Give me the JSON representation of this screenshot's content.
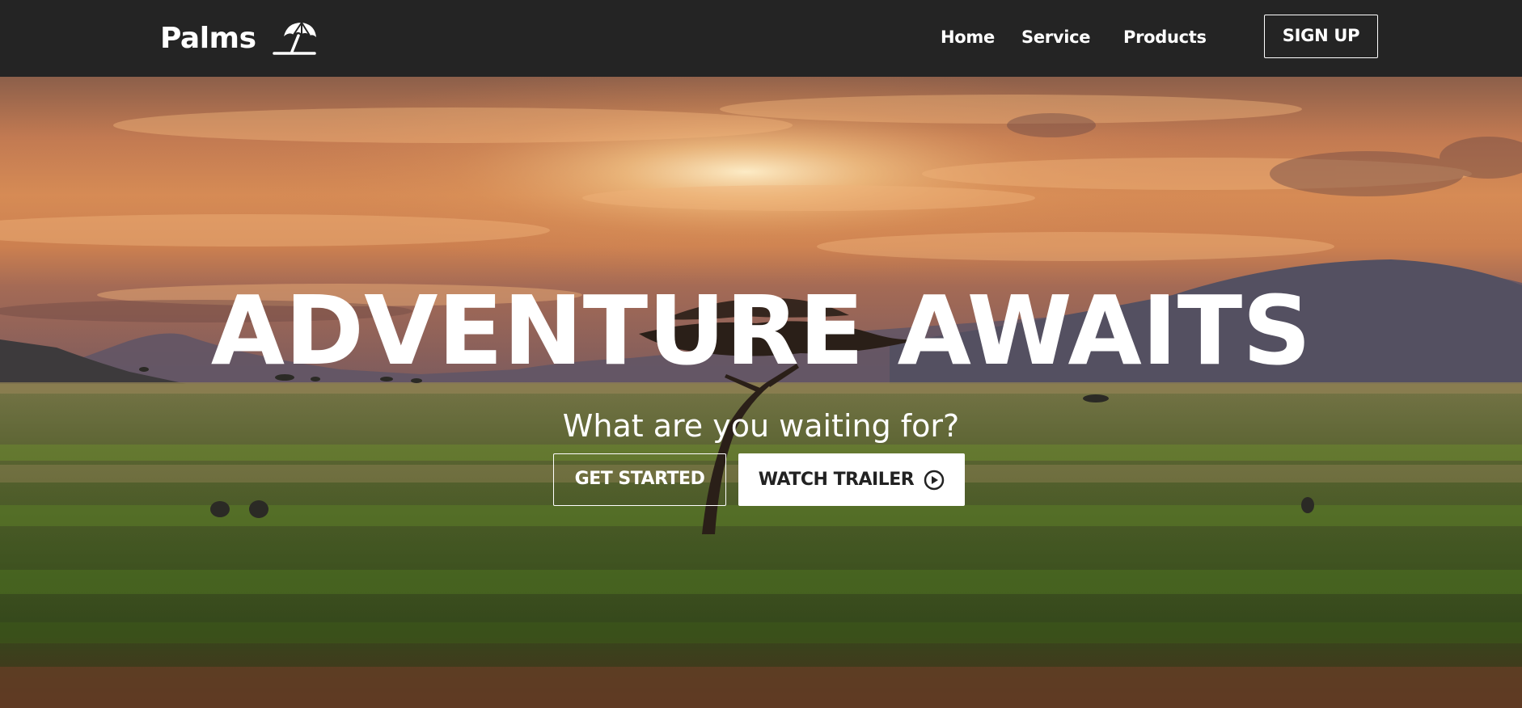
{
  "header": {
    "brand_name": "Palms",
    "brand_icon": "beach-umbrella-icon",
    "nav": [
      {
        "label": "Home"
      },
      {
        "label": "Service"
      },
      {
        "label": "Products"
      }
    ],
    "signup_label": "SIGN UP"
  },
  "hero": {
    "title": "ADVENTURE AWAITS",
    "subtitle": "What are you waiting for?",
    "primary_button": "GET STARTED",
    "secondary_button": "WATCH TRAILER",
    "secondary_icon": "play-circle-icon",
    "background": "savanna-sunset-image"
  },
  "colors": {
    "navbar_bg": "#242424",
    "text": "#ffffff",
    "button_light_bg": "#ffffff",
    "button_dark_text": "#222222"
  }
}
